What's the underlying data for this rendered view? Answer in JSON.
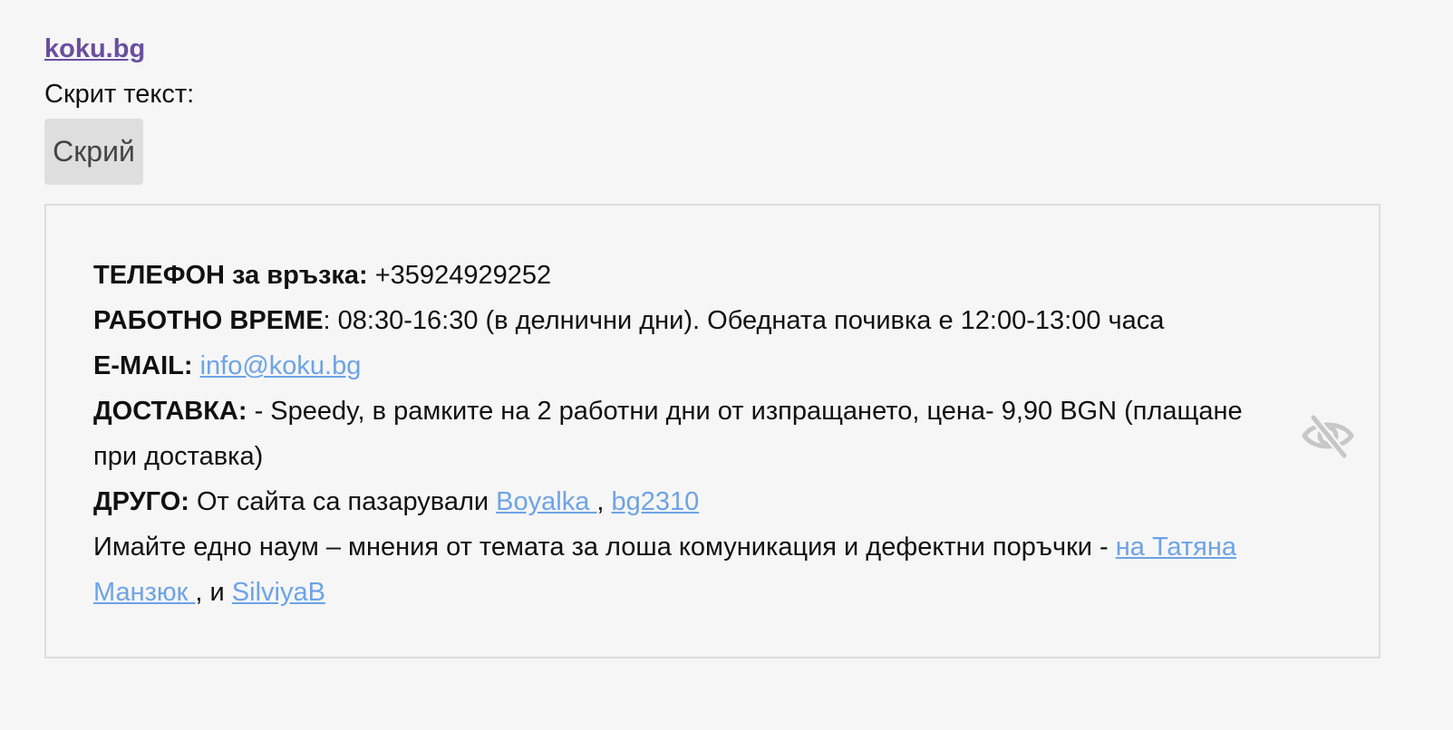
{
  "site_link": "koku.bg",
  "hidden_label": "Скрит текст:",
  "hide_button": "Скрий",
  "box": {
    "phone": {
      "label": "ТЕЛЕФОН за връзка:",
      "value": " +35924929252"
    },
    "hours": {
      "label": "РАБОТНО ВРЕМЕ",
      "value": ": 08:30-16:30 (в делнични дни).  Обедната почивка е 12:00-13:00 часа"
    },
    "email": {
      "label": "E-MAIL:",
      "sep": " ",
      "link": "info@koku.bg"
    },
    "delivery": {
      "label": "ДОСТАВКА:",
      "value": " - Speedy, в рамките на 2 работни дни от изпращането, цена- 9,90 BGN (плащане при доставка)"
    },
    "other": {
      "label": "ДРУГО:",
      "value": " От сайта са пазарували ",
      "link1": "Boyalka ",
      "sep": ", ",
      "link2": "bg2310"
    },
    "note": {
      "text": "Имайте едно наум – мнения от темата за лоша комуникация и дефектни поръчки - ",
      "link1": "на Татяна Манзюк ",
      "sep": ", и ",
      "link2": "SilviyaB"
    }
  },
  "icons": {
    "toggle": "eye-slash-icon"
  },
  "colors": {
    "link": "#6ea3e6",
    "site_link": "#6a4fa0",
    "background": "#f6f6f6"
  }
}
